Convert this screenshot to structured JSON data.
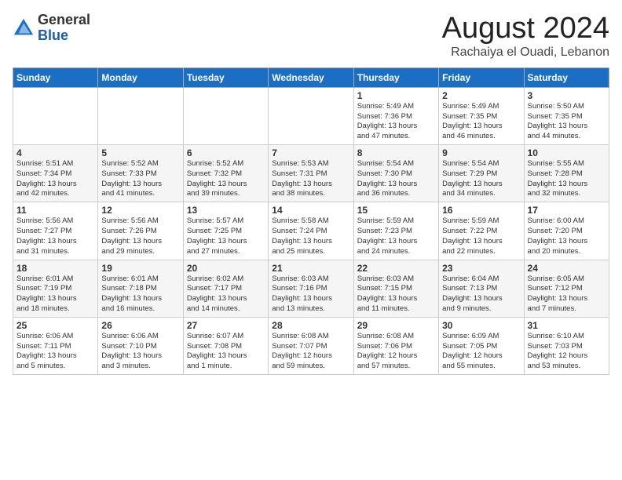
{
  "header": {
    "logo_general": "General",
    "logo_blue": "Blue",
    "month_title": "August 2024",
    "location": "Rachaiya el Ouadi, Lebanon"
  },
  "days_of_week": [
    "Sunday",
    "Monday",
    "Tuesday",
    "Wednesday",
    "Thursday",
    "Friday",
    "Saturday"
  ],
  "weeks": [
    [
      {
        "day": "",
        "info": ""
      },
      {
        "day": "",
        "info": ""
      },
      {
        "day": "",
        "info": ""
      },
      {
        "day": "",
        "info": ""
      },
      {
        "day": "1",
        "info": "Sunrise: 5:49 AM\nSunset: 7:36 PM\nDaylight: 13 hours\nand 47 minutes."
      },
      {
        "day": "2",
        "info": "Sunrise: 5:49 AM\nSunset: 7:35 PM\nDaylight: 13 hours\nand 46 minutes."
      },
      {
        "day": "3",
        "info": "Sunrise: 5:50 AM\nSunset: 7:35 PM\nDaylight: 13 hours\nand 44 minutes."
      }
    ],
    [
      {
        "day": "4",
        "info": "Sunrise: 5:51 AM\nSunset: 7:34 PM\nDaylight: 13 hours\nand 42 minutes."
      },
      {
        "day": "5",
        "info": "Sunrise: 5:52 AM\nSunset: 7:33 PM\nDaylight: 13 hours\nand 41 minutes."
      },
      {
        "day": "6",
        "info": "Sunrise: 5:52 AM\nSunset: 7:32 PM\nDaylight: 13 hours\nand 39 minutes."
      },
      {
        "day": "7",
        "info": "Sunrise: 5:53 AM\nSunset: 7:31 PM\nDaylight: 13 hours\nand 38 minutes."
      },
      {
        "day": "8",
        "info": "Sunrise: 5:54 AM\nSunset: 7:30 PM\nDaylight: 13 hours\nand 36 minutes."
      },
      {
        "day": "9",
        "info": "Sunrise: 5:54 AM\nSunset: 7:29 PM\nDaylight: 13 hours\nand 34 minutes."
      },
      {
        "day": "10",
        "info": "Sunrise: 5:55 AM\nSunset: 7:28 PM\nDaylight: 13 hours\nand 32 minutes."
      }
    ],
    [
      {
        "day": "11",
        "info": "Sunrise: 5:56 AM\nSunset: 7:27 PM\nDaylight: 13 hours\nand 31 minutes."
      },
      {
        "day": "12",
        "info": "Sunrise: 5:56 AM\nSunset: 7:26 PM\nDaylight: 13 hours\nand 29 minutes."
      },
      {
        "day": "13",
        "info": "Sunrise: 5:57 AM\nSunset: 7:25 PM\nDaylight: 13 hours\nand 27 minutes."
      },
      {
        "day": "14",
        "info": "Sunrise: 5:58 AM\nSunset: 7:24 PM\nDaylight: 13 hours\nand 25 minutes."
      },
      {
        "day": "15",
        "info": "Sunrise: 5:59 AM\nSunset: 7:23 PM\nDaylight: 13 hours\nand 24 minutes."
      },
      {
        "day": "16",
        "info": "Sunrise: 5:59 AM\nSunset: 7:22 PM\nDaylight: 13 hours\nand 22 minutes."
      },
      {
        "day": "17",
        "info": "Sunrise: 6:00 AM\nSunset: 7:20 PM\nDaylight: 13 hours\nand 20 minutes."
      }
    ],
    [
      {
        "day": "18",
        "info": "Sunrise: 6:01 AM\nSunset: 7:19 PM\nDaylight: 13 hours\nand 18 minutes."
      },
      {
        "day": "19",
        "info": "Sunrise: 6:01 AM\nSunset: 7:18 PM\nDaylight: 13 hours\nand 16 minutes."
      },
      {
        "day": "20",
        "info": "Sunrise: 6:02 AM\nSunset: 7:17 PM\nDaylight: 13 hours\nand 14 minutes."
      },
      {
        "day": "21",
        "info": "Sunrise: 6:03 AM\nSunset: 7:16 PM\nDaylight: 13 hours\nand 13 minutes."
      },
      {
        "day": "22",
        "info": "Sunrise: 6:03 AM\nSunset: 7:15 PM\nDaylight: 13 hours\nand 11 minutes."
      },
      {
        "day": "23",
        "info": "Sunrise: 6:04 AM\nSunset: 7:13 PM\nDaylight: 13 hours\nand 9 minutes."
      },
      {
        "day": "24",
        "info": "Sunrise: 6:05 AM\nSunset: 7:12 PM\nDaylight: 13 hours\nand 7 minutes."
      }
    ],
    [
      {
        "day": "25",
        "info": "Sunrise: 6:06 AM\nSunset: 7:11 PM\nDaylight: 13 hours\nand 5 minutes."
      },
      {
        "day": "26",
        "info": "Sunrise: 6:06 AM\nSunset: 7:10 PM\nDaylight: 13 hours\nand 3 minutes."
      },
      {
        "day": "27",
        "info": "Sunrise: 6:07 AM\nSunset: 7:08 PM\nDaylight: 13 hours\nand 1 minute."
      },
      {
        "day": "28",
        "info": "Sunrise: 6:08 AM\nSunset: 7:07 PM\nDaylight: 12 hours\nand 59 minutes."
      },
      {
        "day": "29",
        "info": "Sunrise: 6:08 AM\nSunset: 7:06 PM\nDaylight: 12 hours\nand 57 minutes."
      },
      {
        "day": "30",
        "info": "Sunrise: 6:09 AM\nSunset: 7:05 PM\nDaylight: 12 hours\nand 55 minutes."
      },
      {
        "day": "31",
        "info": "Sunrise: 6:10 AM\nSunset: 7:03 PM\nDaylight: 12 hours\nand 53 minutes."
      }
    ]
  ]
}
